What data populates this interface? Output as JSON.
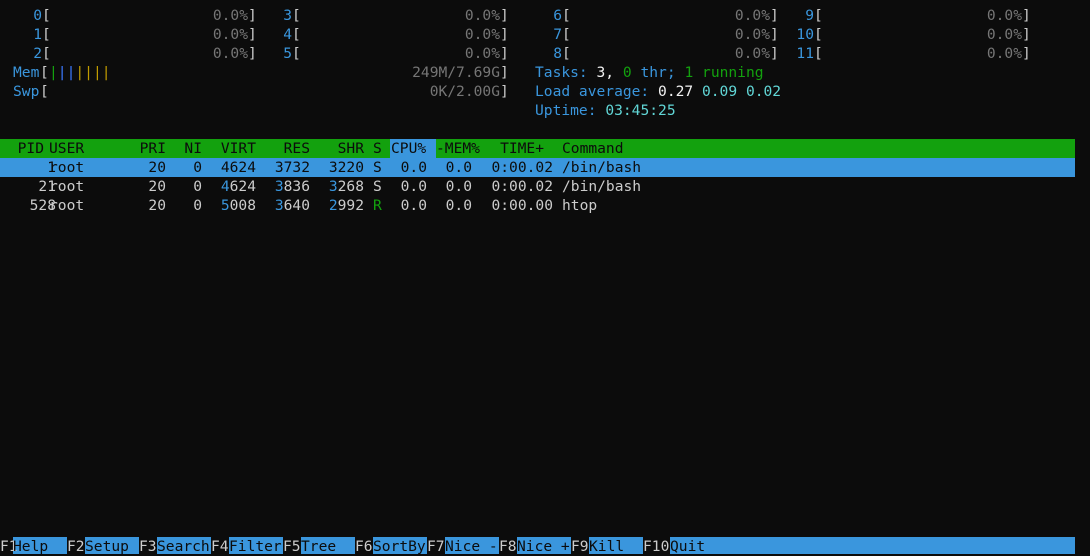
{
  "cpus": [
    {
      "id": "0",
      "value": "0.0%"
    },
    {
      "id": "1",
      "value": "0.0%"
    },
    {
      "id": "2",
      "value": "0.0%"
    },
    {
      "id": "3",
      "value": "0.0%"
    },
    {
      "id": "4",
      "value": "0.0%"
    },
    {
      "id": "5",
      "value": "0.0%"
    },
    {
      "id": "6",
      "value": "0.0%"
    },
    {
      "id": "7",
      "value": "0.0%"
    },
    {
      "id": "8",
      "value": "0.0%"
    },
    {
      "id": "9",
      "value": "0.0%"
    },
    {
      "id": "10",
      "value": "0.0%"
    },
    {
      "id": "11",
      "value": "0.0%"
    }
  ],
  "mem": {
    "label": "Mem",
    "bar": "|||||||",
    "value": "249M/7.69G"
  },
  "swp": {
    "label": "Swp",
    "value": "0K/2.00G"
  },
  "tasks": {
    "label": "Tasks:",
    "count": "3,",
    "thr": "0",
    "thr_label": "thr;",
    "running": "1",
    "running_label": "running"
  },
  "load": {
    "label": "Load average:",
    "l1": "0.27",
    "l5": "0.09",
    "l15": "0.02"
  },
  "uptime": {
    "label": "Uptime:",
    "value": "03:45:25"
  },
  "columns": {
    "pid": "PID",
    "user": "USER",
    "pri": "PRI",
    "ni": "NI",
    "virt": "VIRT",
    "res": "RES",
    "shr": "SHR",
    "s": "S",
    "cpu": "CPU%",
    "mem": "-MEM%",
    "time": "TIME+",
    "command": "Command"
  },
  "processes": [
    {
      "pid": "1",
      "user": "root",
      "pri": "20",
      "ni": "0",
      "virt": "4624",
      "res": "3732",
      "shr": "3220",
      "s": "S",
      "cpu": "0.0",
      "mem": "0.0",
      "time": "0:00.02",
      "command": "/bin/bash"
    },
    {
      "pid": "21",
      "user": "root",
      "pri": "20",
      "ni": "0",
      "virt_hi": "4",
      "virt_rest": "624",
      "res_hi": "3",
      "res_rest": "836",
      "shr_hi": "3",
      "shr_rest": "268",
      "s": "S",
      "cpu": "0.0",
      "mem": "0.0",
      "time": "0:00.02",
      "command": "/bin/bash"
    },
    {
      "pid": "528",
      "user": "root",
      "pri": "20",
      "ni": "0",
      "virt_hi": "5",
      "virt_rest": "008",
      "res_hi": "3",
      "res_rest": "640",
      "shr_hi": "2",
      "shr_rest": "992",
      "s": "R",
      "cpu": "0.0",
      "mem": "0.0",
      "time": "0:00.00",
      "command": "htop"
    }
  ],
  "fkeys": [
    {
      "key": "F1",
      "label": "Help"
    },
    {
      "key": "F2",
      "label": "Setup"
    },
    {
      "key": "F3",
      "label": "Search"
    },
    {
      "key": "F4",
      "label": "Filter"
    },
    {
      "key": "F5",
      "label": "Tree"
    },
    {
      "key": "F6",
      "label": "SortBy"
    },
    {
      "key": "F7",
      "label": "Nice -"
    },
    {
      "key": "F8",
      "label": "Nice +"
    },
    {
      "key": "F9",
      "label": "Kill"
    },
    {
      "key": "F10",
      "label": "Quit"
    }
  ]
}
